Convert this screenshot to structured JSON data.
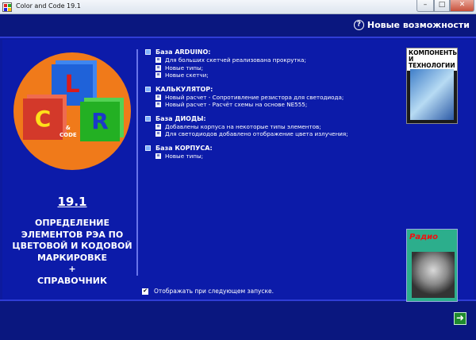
{
  "window": {
    "title": "Color and Code 19.1",
    "minimize_glyph": "–",
    "maximize_glyph": "□",
    "close_glyph": "✕"
  },
  "header": {
    "whats_new": "Новые возможности",
    "help_glyph": "?"
  },
  "logo": {
    "letter_l": "L",
    "letter_c": "C",
    "letter_r": "R",
    "amp": "&",
    "code": "CODE"
  },
  "version": "19.1",
  "description_lines": [
    "ОПРЕДЕЛЕНИЕ",
    "ЭЛЕМЕНТОВ РЭА ПО",
    "ЦВЕТОВОЙ И КОДОВОЙ",
    "МАРКИРОВКЕ",
    "+",
    "СПРАВОЧНИК"
  ],
  "news": {
    "sections": [
      {
        "title": "База ARDUINO:",
        "items": [
          "Для больших скетчей реализована прокрутка;",
          "Новые типы;",
          "Новые скетчи;"
        ]
      },
      {
        "title": "КАЛЬКУЛЯТОР:",
        "items": [
          "Новый расчет - Сопротивление резистора для светодиода;",
          "Новый расчет - Расчёт схемы на основе NE555;"
        ]
      },
      {
        "title": "База ДИОДЫ:",
        "items": [
          "Добавлены корпуса на некоторые типы элементов;",
          "Для светодиодов добавлено отображение цвета излучения;"
        ]
      },
      {
        "title": "База КОРПУСА:",
        "items": [
          "Новые типы;"
        ]
      }
    ]
  },
  "magazine1": {
    "title_line1": "КОМПОНЕНТЫ",
    "title_line2": "И ТЕХНОЛОГИИ"
  },
  "magazine2": {
    "title": "Радио"
  },
  "startup_checkbox": {
    "label": "Отображать при следующем запуске.",
    "checked_glyph": "✔"
  },
  "footer": {
    "next_glyph": "➜"
  },
  "colors": {
    "background": "#0d1a9e",
    "bar": "#0a177f",
    "logo_orange": "#f07a1a",
    "cube_blue": "#1f62d9",
    "cube_red": "#d3392a",
    "cube_green": "#23b023"
  }
}
